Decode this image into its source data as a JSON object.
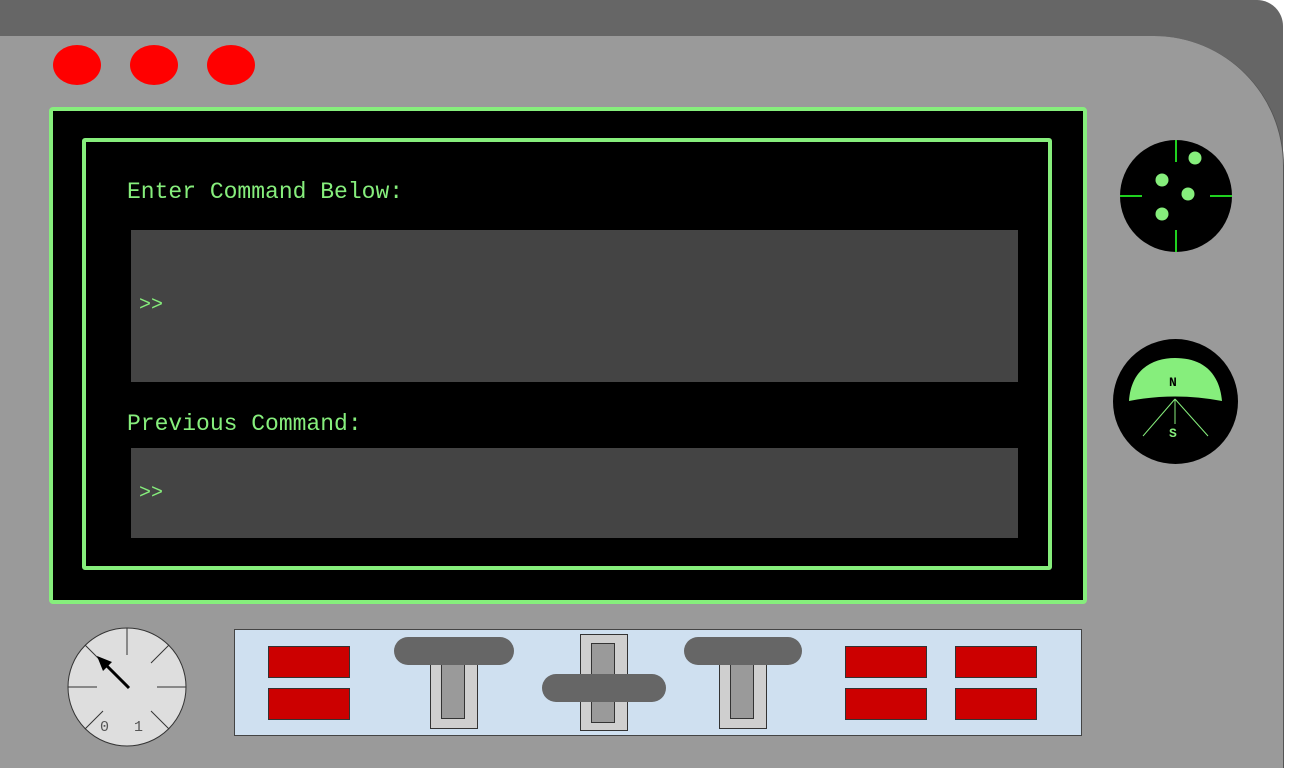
{
  "terminal": {
    "enter_label": "Enter Command Below:",
    "enter_prompt": ">>",
    "previous_label": "Previous Command:",
    "previous_prompt": ">>"
  },
  "compass": {
    "north": "N",
    "south": "S"
  },
  "gauge": {
    "tick_0": "0",
    "tick_1": "1"
  },
  "colors": {
    "accent_green": "#86ee7c",
    "warning_red": "#ff0000",
    "button_red": "#cc0000",
    "panel_gray": "#9a9a9a",
    "control_panel": "#cfe0f0"
  }
}
